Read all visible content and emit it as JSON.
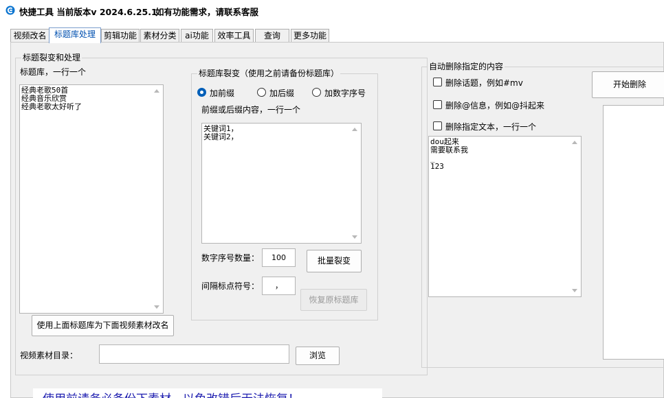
{
  "app": {
    "title": "快捷工具 当前版本v 2024.6.25.1",
    "notice": "如有功能需求，请联系客服",
    "accent_color": "#0a74d0"
  },
  "tabs": [
    {
      "label": "视频改名",
      "active": false
    },
    {
      "label": "标题库处理",
      "active": true
    },
    {
      "label": "剪辑功能",
      "active": false
    },
    {
      "label": "素材分类",
      "active": false
    },
    {
      "label": "ai功能",
      "active": false
    },
    {
      "label": "效率工具",
      "active": false
    },
    {
      "label": "查询",
      "active": false
    },
    {
      "label": "更多功能",
      "active": false
    }
  ],
  "title_processing": {
    "group_title": "标题裂变和处理",
    "library_label": "标题库，一行一个",
    "library_lines": [
      "经典老歌50首",
      "经典音乐欣赏",
      "经典老歌太好听了"
    ],
    "rename_button": "使用上面标题库为下面视频素材改名",
    "video_dir_label": "视频素材目录：",
    "video_dir_value": "",
    "browse_button": "浏览"
  },
  "fission": {
    "group_title": "标题库裂变（使用之前请备份标题库）",
    "options": [
      {
        "label": "加前缀",
        "checked": true
      },
      {
        "label": "加后缀",
        "checked": false
      },
      {
        "label": "加数字序号",
        "checked": false
      }
    ],
    "content_label": "前缀或后缀内容，一行一个",
    "content_lines": [
      "关键词1，",
      "关键词2，"
    ],
    "count_label": "数字序号数量：",
    "count_value": "100",
    "separator_label": "间隔标点符号：",
    "separator_value": "，",
    "batch_button": "批量裂变",
    "restore_button": "恢复原标题库"
  },
  "auto_delete": {
    "group_title": "自动删除指定的内容",
    "checkboxes": [
      {
        "label": "删除话题，例如#mv",
        "checked": false
      },
      {
        "label": "删除@信息，例如@抖起来",
        "checked": false
      },
      {
        "label": "删除指定文本，一行一个",
        "checked": false
      }
    ],
    "text_lines": [
      "dou起来",
      "需要联系我",
      "_",
      "123"
    ],
    "start_button": "开始删除"
  },
  "warning": "使用前请务必备份下素材，以免改错后无法恢复！"
}
